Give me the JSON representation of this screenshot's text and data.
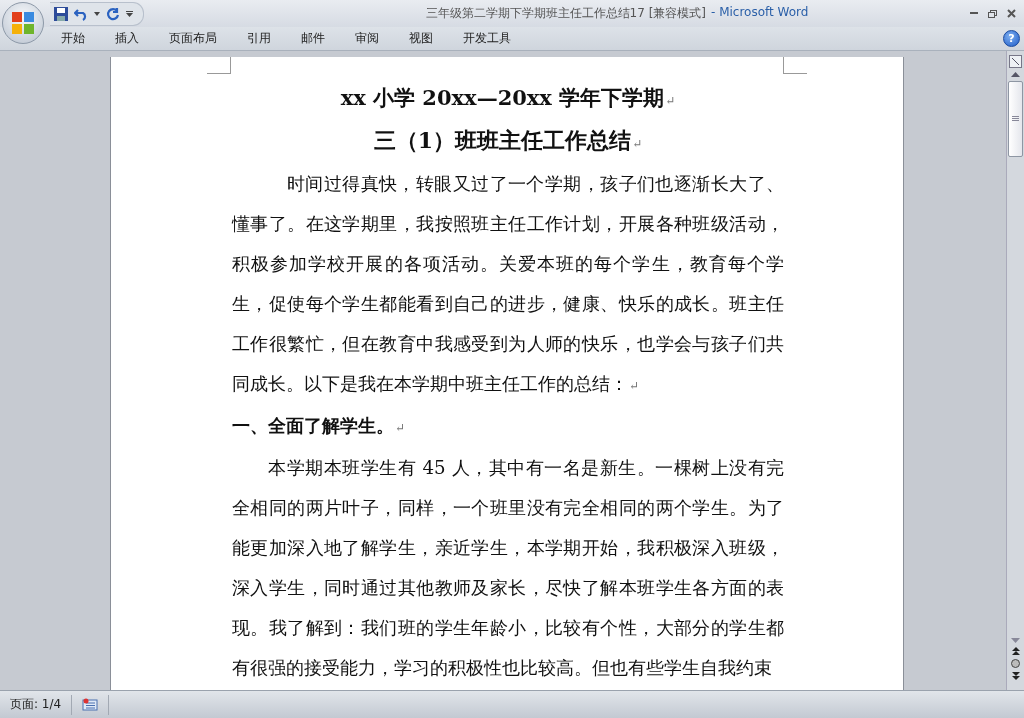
{
  "window": {
    "document_title": "三年级第二学期下学期班主任工作总结17 [兼容模式]",
    "app_name": "- Microsoft Word",
    "help": "?"
  },
  "tabs": [
    {
      "label": "开始"
    },
    {
      "label": "插入"
    },
    {
      "label": "页面布局"
    },
    {
      "label": "引用"
    },
    {
      "label": "邮件"
    },
    {
      "label": "审阅"
    },
    {
      "label": "视图"
    },
    {
      "label": "开发工具"
    }
  ],
  "document": {
    "paragraphs": [
      {
        "kind": "title",
        "text": "xx 小学 20xx—20xx  学年下学期",
        "end": "↵"
      },
      {
        "kind": "subtitle",
        "text": "三（1）班班主任工作总结",
        "end": "↵"
      },
      {
        "kind": "body",
        "text": "　时间过得真快，转眼又过了一个学期，孩子们也逐渐长大了、懂事了。在这学期里，我按照班主任工作计划，开展各种班级活动，积极参加学校开展的各项活动。关爱本班的每个学生，教育每个学生，促使每个学生都能看到自己的进步，健康、快乐的成长。班主任工作很繁忙，但在教育中我感受到为人师的快乐，也学会与孩子们共同成长。以下是我在本学期中班主任工作的总结：",
        "end": "↵"
      },
      {
        "kind": "heading",
        "text": "一、全面了解学生。",
        "end": "↵"
      },
      {
        "kind": "body",
        "text": "本学期本班学生有 45 人，其中有一名是新生。一棵树上没有完全相同的两片叶子，同样，一个班里没有完全相同的两个学生。为了能更加深入地了解学生，亲近学生，本学期开始，我积极深入班级，深入学生，同时通过其他教师及家长，尽快了解本班学生各方面的表现。我了解到：我们班的学生年龄小，比较有个性，大部分的学生都有很强的接受能力，学习的积极性也比较高。但也有些学生自我约束"
      }
    ]
  },
  "status_bar": {
    "page": "页面: 1/4"
  }
}
